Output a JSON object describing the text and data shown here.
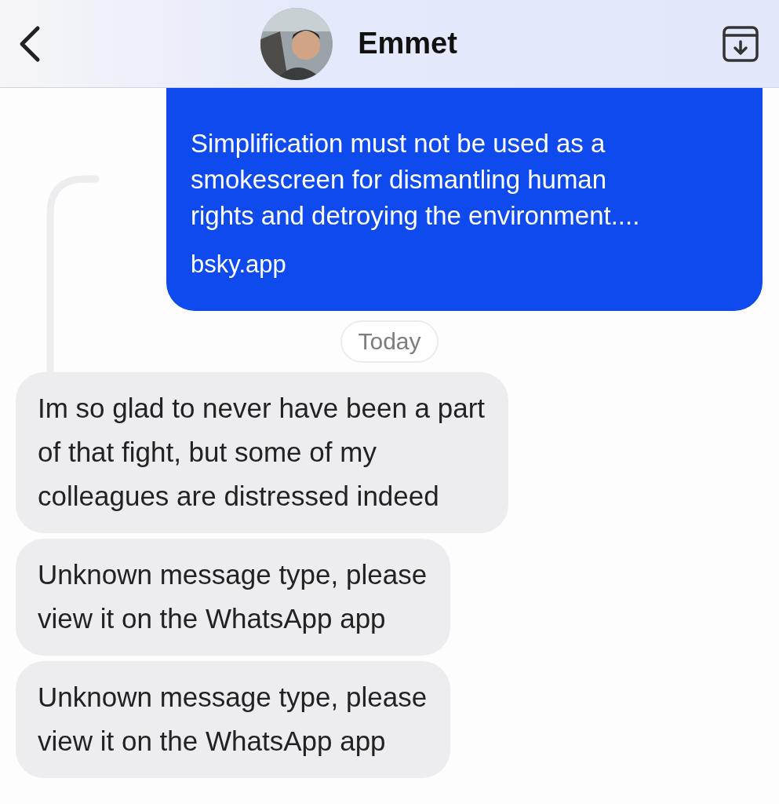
{
  "header": {
    "contact_name": "Emmet"
  },
  "messages": [
    {
      "kind": "link_preview",
      "outgoing": true,
      "reply_connector": true,
      "lines": [
        "Simplification must not be used as a",
        "smokescreen for dismantling human",
        "rights and detroying the environment...."
      ],
      "domain": "bsky.app"
    },
    {
      "kind": "date",
      "label": "Today"
    },
    {
      "kind": "text",
      "outgoing": false,
      "lines": [
        "Im so glad to never have been a part",
        "of that fight, but some of my",
        "colleagues are distressed indeed"
      ]
    },
    {
      "kind": "text",
      "outgoing": false,
      "lines": [
        "Unknown message type, please",
        "view it on the WhatsApp app"
      ]
    },
    {
      "kind": "text",
      "outgoing": false,
      "lines": [
        "Unknown message type, please",
        "view it on the WhatsApp app"
      ]
    }
  ]
}
